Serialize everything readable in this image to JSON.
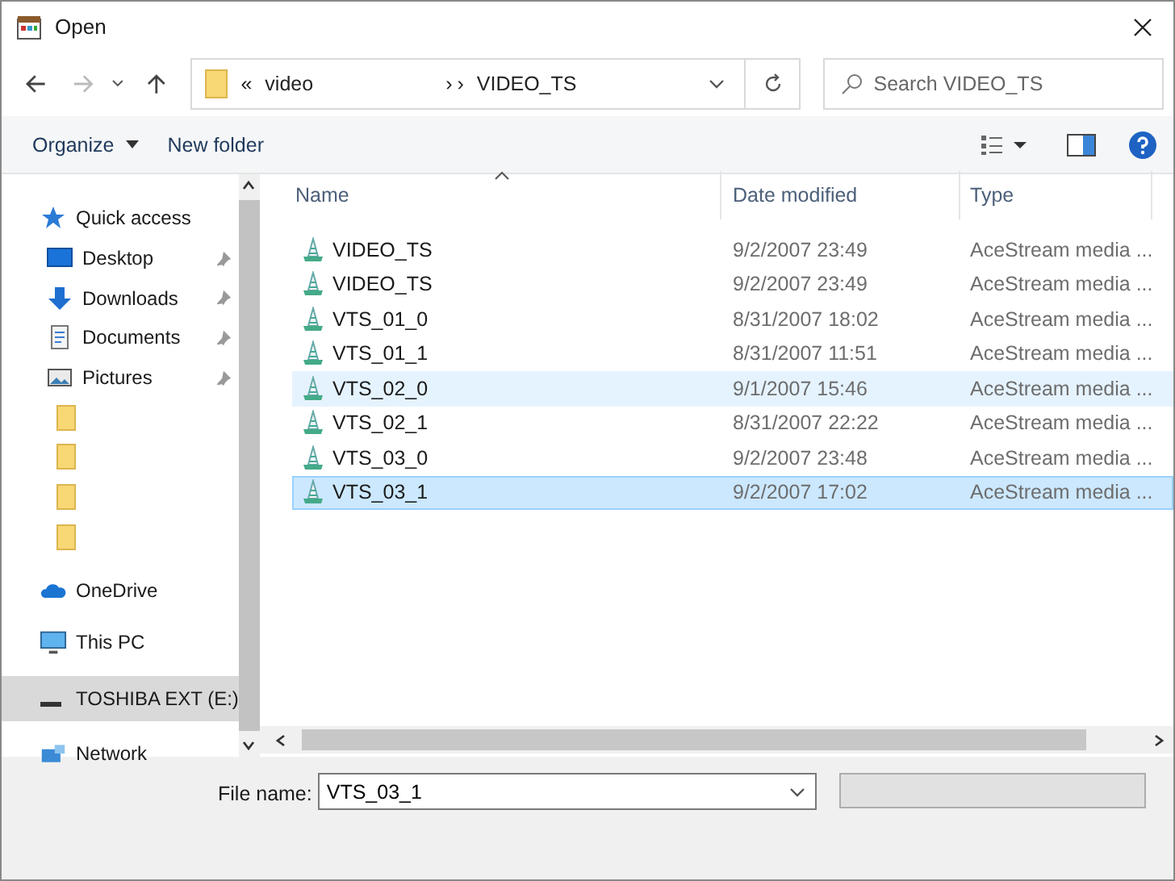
{
  "window": {
    "title": "Open"
  },
  "address": {
    "crumbs": [
      "«",
      "video",
      "›",
      "›",
      "VIDEO_TS"
    ]
  },
  "search": {
    "placeholder": "Search VIDEO_TS"
  },
  "toolbar": {
    "organize": "Organize",
    "new_folder": "New folder"
  },
  "sidebar": {
    "items": [
      {
        "kind": "quick",
        "label": "Quick access",
        "pinned": false,
        "selected": false
      },
      {
        "kind": "desktop",
        "label": "Desktop",
        "pinned": true,
        "selected": false
      },
      {
        "kind": "downloads",
        "label": "Downloads",
        "pinned": true,
        "selected": false
      },
      {
        "kind": "documents",
        "label": "Documents",
        "pinned": true,
        "selected": false
      },
      {
        "kind": "pictures",
        "label": "Pictures",
        "pinned": true,
        "selected": false
      },
      {
        "kind": "folder",
        "pinned": false,
        "selected": false
      },
      {
        "kind": "folder",
        "pinned": false,
        "selected": false
      },
      {
        "kind": "folder",
        "pinned": false,
        "selected": false
      },
      {
        "kind": "folder",
        "pinned": false,
        "selected": false
      },
      {
        "kind": "onedrive",
        "label": "OneDrive",
        "pinned": false,
        "selected": false
      },
      {
        "kind": "thispc",
        "label": "This PC",
        "pinned": false,
        "selected": false
      },
      {
        "kind": "drive",
        "label": "TOSHIBA EXT (E:)",
        "pinned": false,
        "selected": true
      },
      {
        "kind": "network",
        "label": "Network",
        "pinned": false,
        "selected": false
      }
    ]
  },
  "table": {
    "columns": [
      "Name",
      "Date modified",
      "Type"
    ],
    "rows": [
      {
        "name": "VIDEO_TS",
        "date": "9/2/2007 23:49",
        "type": "AceStream media ...",
        "hovered": false,
        "selected": false
      },
      {
        "name": "VIDEO_TS",
        "date": "9/2/2007 23:49",
        "type": "AceStream media ...",
        "hovered": false,
        "selected": false
      },
      {
        "name": "VTS_01_0",
        "date": "8/31/2007 18:02",
        "type": "AceStream media ...",
        "hovered": false,
        "selected": false
      },
      {
        "name": "VTS_01_1",
        "date": "8/31/2007 11:51",
        "type": "AceStream media ...",
        "hovered": false,
        "selected": false
      },
      {
        "name": "VTS_02_0",
        "date": "9/1/2007 15:46",
        "type": "AceStream media ...",
        "hovered": true,
        "selected": false
      },
      {
        "name": "VTS_02_1",
        "date": "8/31/2007 22:22",
        "type": "AceStream media ...",
        "hovered": false,
        "selected": false
      },
      {
        "name": "VTS_03_0",
        "date": "9/2/2007 23:48",
        "type": "AceStream media ...",
        "hovered": false,
        "selected": false
      },
      {
        "name": "VTS_03_1",
        "date": "9/2/2007 17:02",
        "type": "AceStream media ...",
        "hovered": false,
        "selected": true
      }
    ]
  },
  "footer": {
    "file_name_label": "File name:",
    "file_name": "VTS_03_1"
  }
}
